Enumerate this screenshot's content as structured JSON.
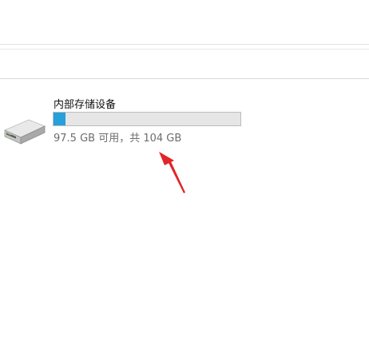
{
  "drive": {
    "name": "内部存储设备",
    "info": "97.5 GB 可用，共 104 GB",
    "used_fraction": 0.0625,
    "icon": "hard-drive-icon"
  },
  "colors": {
    "capacity_fill": "#26a0da",
    "capacity_track": "#e6e6e6",
    "annotation_arrow": "#e0252b"
  }
}
